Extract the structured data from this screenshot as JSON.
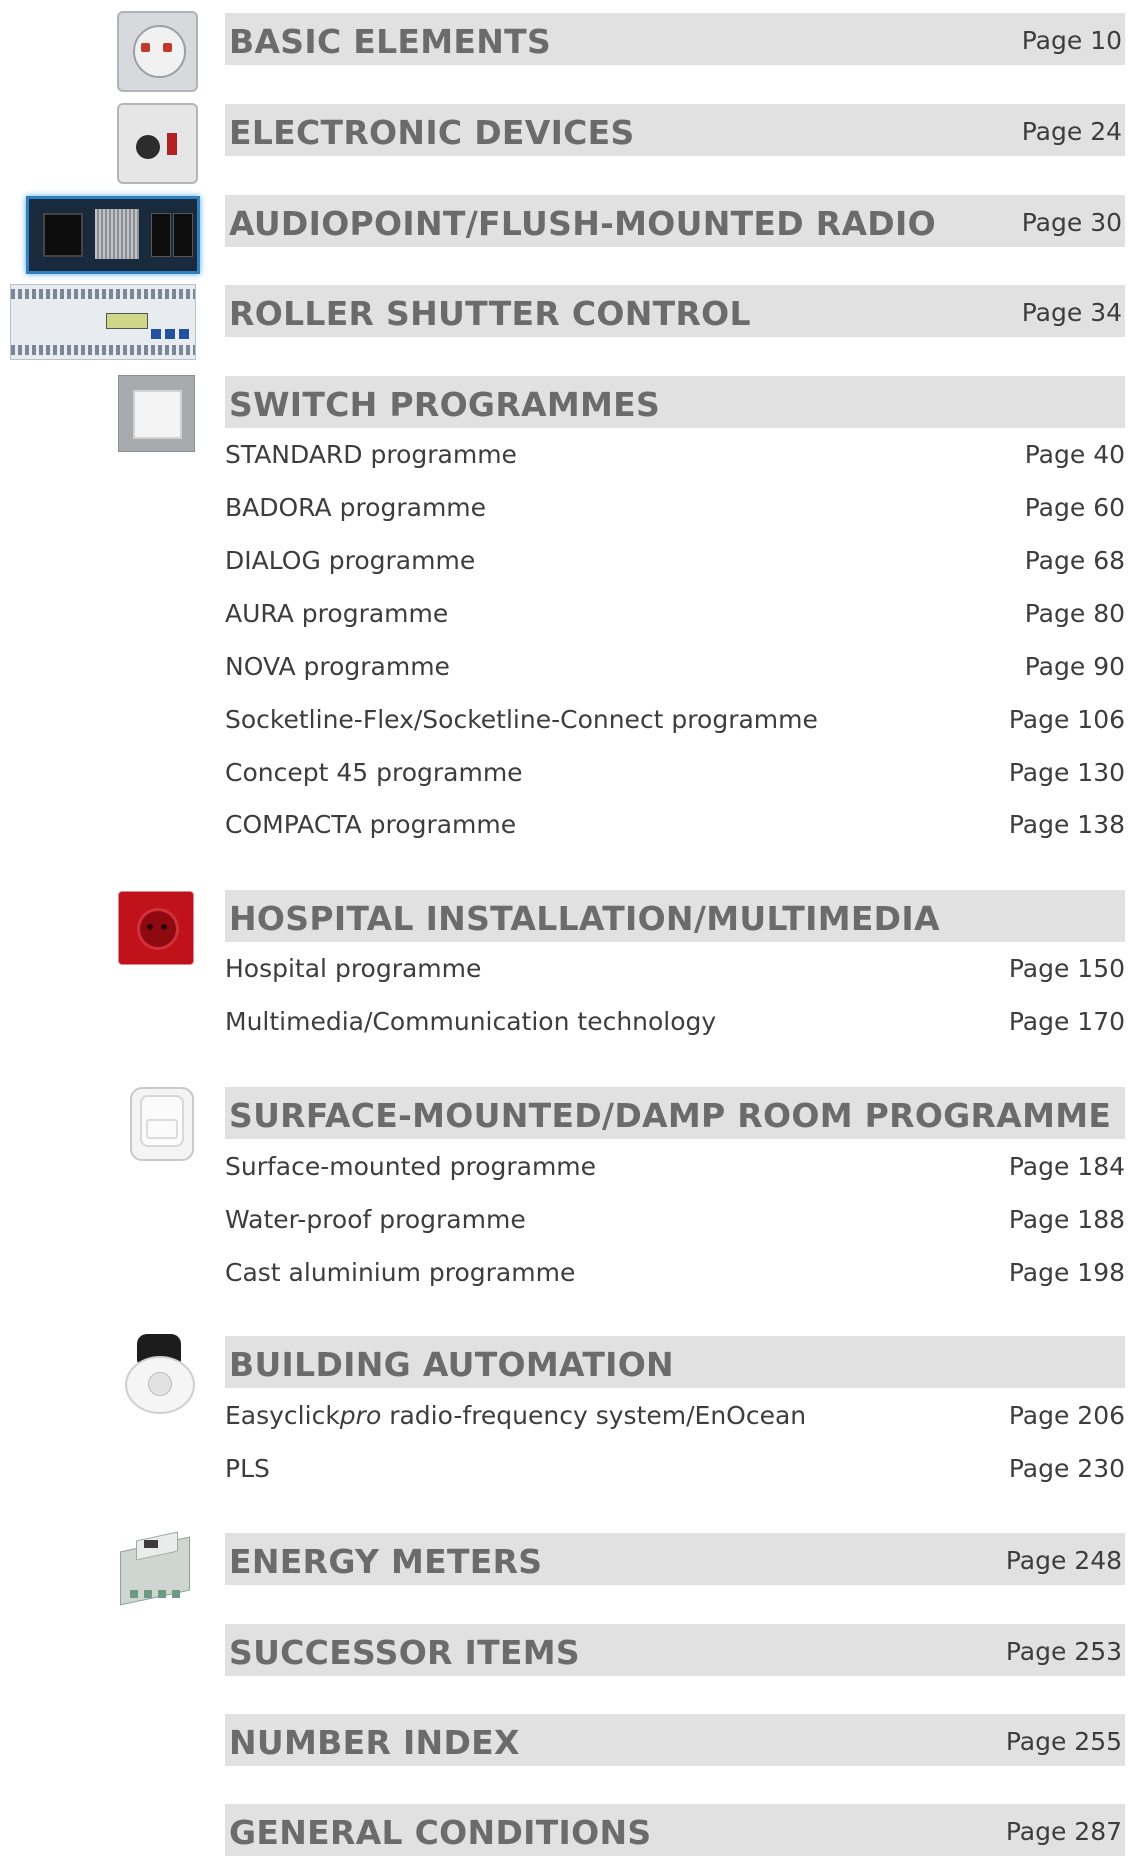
{
  "sections": [
    {
      "title": "BASIC ELEMENTS",
      "page": "Page 10",
      "icon": "flush-socket-insert-icon"
    },
    {
      "title": "ELECTRONIC DEVICES",
      "page": "Page 24",
      "icon": "dimmer-insert-icon"
    },
    {
      "title": "AUDIOPOINT/FLUSH-MOUNTED RADIO",
      "page": "Page 30",
      "icon": "radio-panel-icon"
    },
    {
      "title": "ROLLER SHUTTER CONTROL",
      "page": "Page 34",
      "icon": "din-rail-controller-icon"
    },
    {
      "title": "SWITCH PROGRAMMES",
      "page": "",
      "icon": "rocker-switch-icon",
      "items": [
        {
          "label": "STANDARD programme",
          "page": "Page 40"
        },
        {
          "label": "BADORA programme",
          "page": "Page 60"
        },
        {
          "label": "DIALOG programme",
          "page": "Page 68"
        },
        {
          "label": "AURA programme",
          "page": "Page 80"
        },
        {
          "label": "NOVA programme",
          "page": "Page 90"
        },
        {
          "label": "Socketline-Flex/Socketline-Connect programme",
          "page": "Page 106"
        },
        {
          "label": "Concept 45 programme",
          "page": "Page 130"
        },
        {
          "label": "COMPACTA programme",
          "page": "Page 138"
        }
      ]
    },
    {
      "title": "HOSPITAL INSTALLATION/MULTIMEDIA",
      "page": "",
      "icon": "red-socket-icon",
      "items": [
        {
          "label": "Hospital programme",
          "page": "Page 150"
        },
        {
          "label": "Multimedia/Communication technology",
          "page": "Page 170"
        }
      ]
    },
    {
      "title": "SURFACE-MOUNTED/DAMP ROOM PROGRAMME",
      "page": "",
      "icon": "damp-room-socket-icon",
      "items": [
        {
          "label": "Surface-mounted programme",
          "page": "Page 184"
        },
        {
          "label": "Water-proof programme",
          "page": "Page 188"
        },
        {
          "label": "Cast aluminium programme",
          "page": "Page 198"
        }
      ]
    },
    {
      "title": "BUILDING AUTOMATION",
      "page": "",
      "icon": "motion-detector-icon",
      "items": [
        {
          "label_prefix": "Easyclick",
          "label_italic": "pro",
          "label_suffix": " radio-frequency system/EnOcean",
          "page": "Page 206"
        },
        {
          "label": "PLS",
          "page": "Page 230"
        }
      ]
    },
    {
      "title": "ENERGY METERS",
      "page": "Page 248",
      "icon": "energy-meter-icon"
    },
    {
      "title": "SUCCESSOR ITEMS",
      "page": "Page 253"
    },
    {
      "title": "NUMBER INDEX",
      "page": "Page 255"
    },
    {
      "title": "GENERAL CONDITIONS",
      "page": "Page 287"
    }
  ]
}
